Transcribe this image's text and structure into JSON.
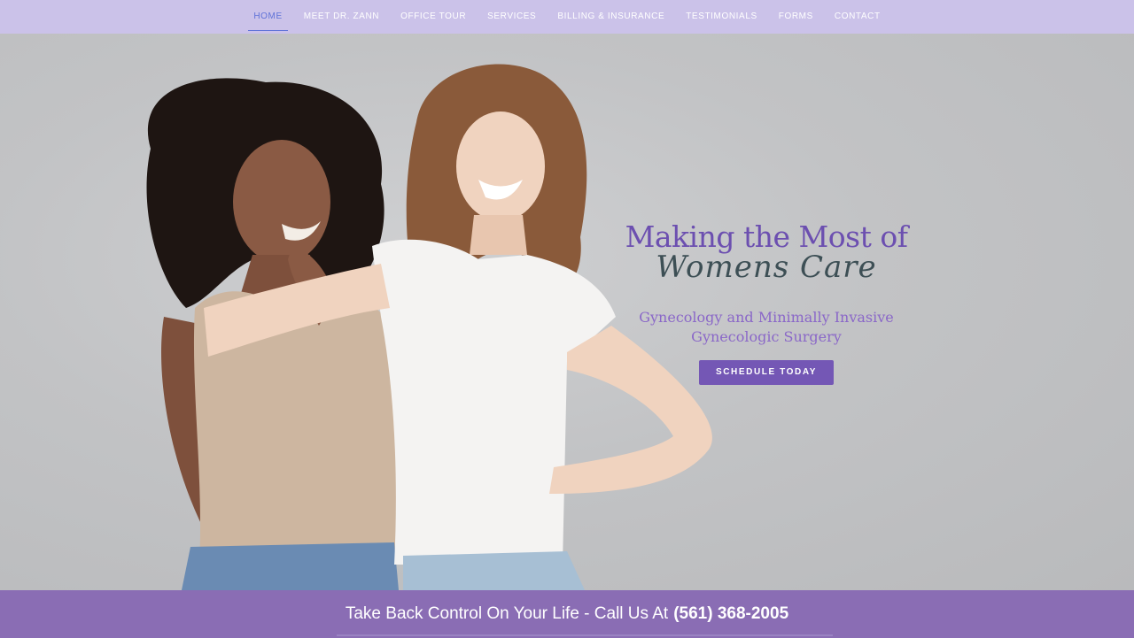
{
  "nav": {
    "items": [
      {
        "label": "HOME",
        "active": true
      },
      {
        "label": "MEET DR. ZANN",
        "active": false
      },
      {
        "label": "OFFICE TOUR",
        "active": false
      },
      {
        "label": "SERVICES",
        "active": false
      },
      {
        "label": "BILLING & INSURANCE",
        "active": false
      },
      {
        "label": "TESTIMONIALS",
        "active": false
      },
      {
        "label": "FORMS",
        "active": false
      },
      {
        "label": "CONTACT",
        "active": false
      }
    ]
  },
  "hero": {
    "title": "Making the Most of",
    "script_title": "Womens Care",
    "subtitle_line1": "Gynecology and Minimally Invasive",
    "subtitle_line2": "Gynecologic Surgery",
    "cta_label": "SCHEDULE TODAY"
  },
  "callbar": {
    "text": "Take Back Control On Your Life - Call Us At",
    "phone": "(561) 368-2005"
  },
  "colors": {
    "nav_bg": "#cbc2e9",
    "nav_active": "#5f72d8",
    "brand_purple": "#7457b5",
    "callbar_bg": "#8a6db4",
    "hero_bg": "#c2c3c5"
  }
}
